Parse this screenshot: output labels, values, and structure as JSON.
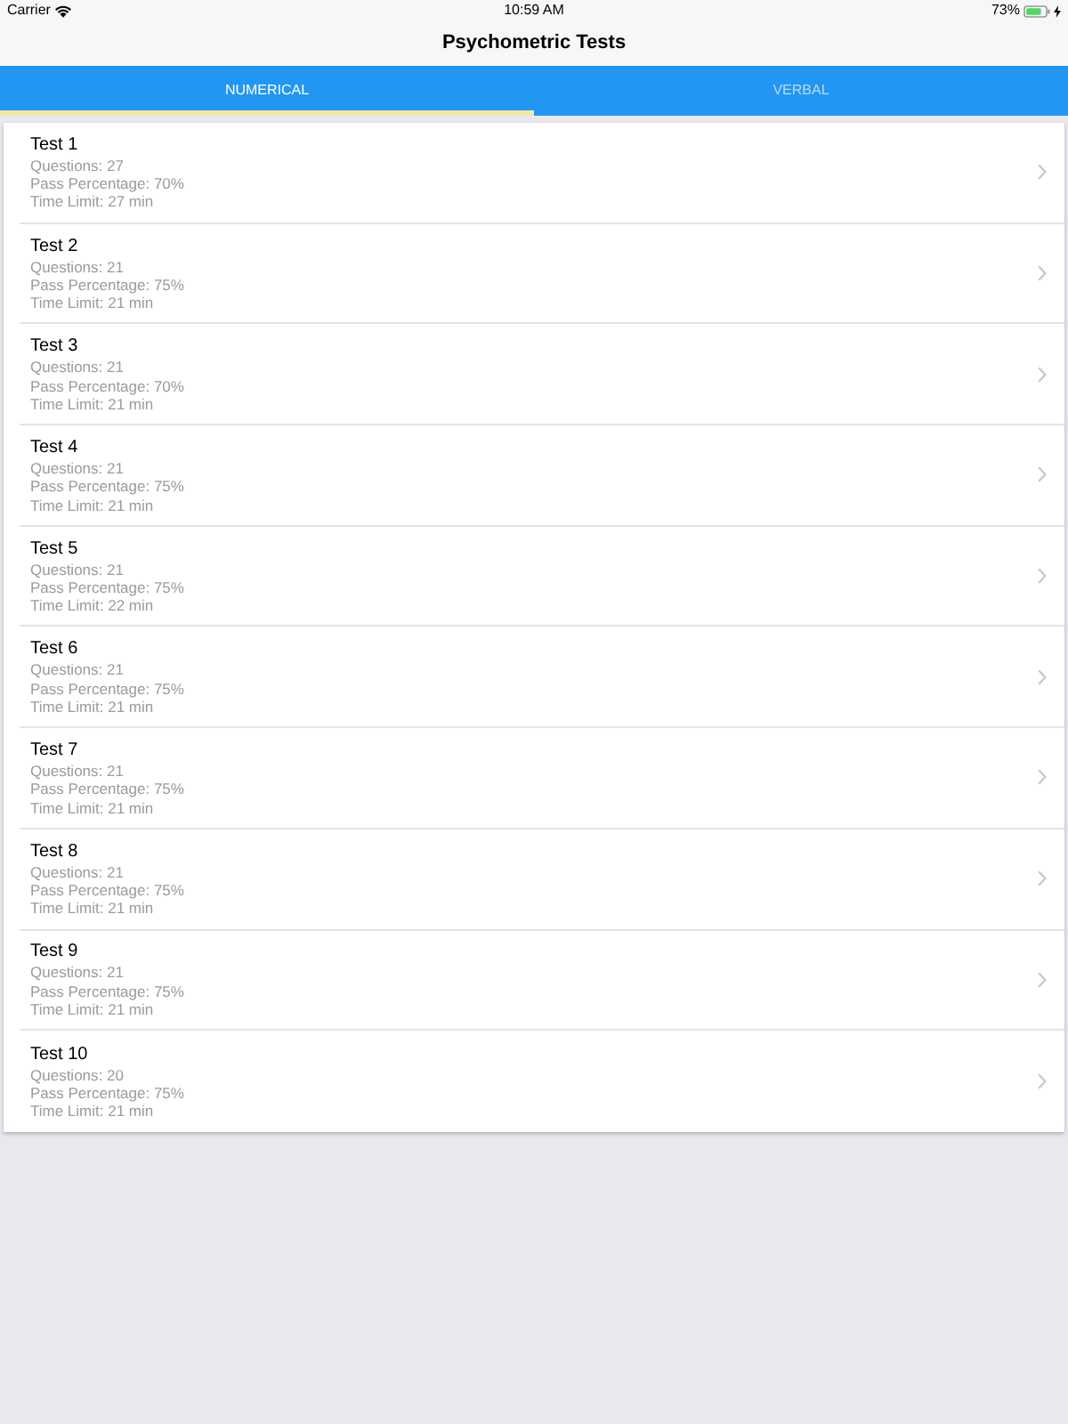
{
  "status_bar": {
    "carrier": "Carrier",
    "time": "10:59 AM",
    "battery": "73%"
  },
  "nav_bar": {
    "title": "Psychometric Tests"
  },
  "tabs": [
    {
      "label": "NUMERICAL",
      "selected": true
    },
    {
      "label": "VERBAL",
      "selected": false
    }
  ],
  "tests": [
    {
      "title": "Test 1",
      "questions": "Questions: 27",
      "pass": "Pass Percentage: 70%",
      "time": "Time Limit: 27 min"
    },
    {
      "title": "Test 2",
      "questions": "Questions: 21",
      "pass": "Pass Percentage: 75%",
      "time": "Time Limit: 21 min"
    },
    {
      "title": "Test 3",
      "questions": "Questions: 21",
      "pass": "Pass Percentage: 70%",
      "time": "Time Limit: 21 min"
    },
    {
      "title": "Test 4",
      "questions": "Questions: 21",
      "pass": "Pass Percentage: 75%",
      "time": "Time Limit: 21 min"
    },
    {
      "title": "Test 5",
      "questions": "Questions: 21",
      "pass": "Pass Percentage: 75%",
      "time": "Time Limit: 22 min"
    },
    {
      "title": "Test 6",
      "questions": "Questions: 21",
      "pass": "Pass Percentage: 75%",
      "time": "Time Limit: 21 min"
    },
    {
      "title": "Test 7",
      "questions": "Questions: 21",
      "pass": "Pass Percentage: 75%",
      "time": "Time Limit: 21 min"
    },
    {
      "title": "Test 8",
      "questions": "Questions: 21",
      "pass": "Pass Percentage: 75%",
      "time": "Time Limit: 21 min"
    },
    {
      "title": "Test 9",
      "questions": "Questions: 21",
      "pass": "Pass Percentage: 75%",
      "time": "Time Limit: 21 min"
    },
    {
      "title": "Test 10",
      "questions": "Questions: 20",
      "pass": "Pass Percentage: 75%",
      "time": "Time Limit: 21 min"
    }
  ]
}
